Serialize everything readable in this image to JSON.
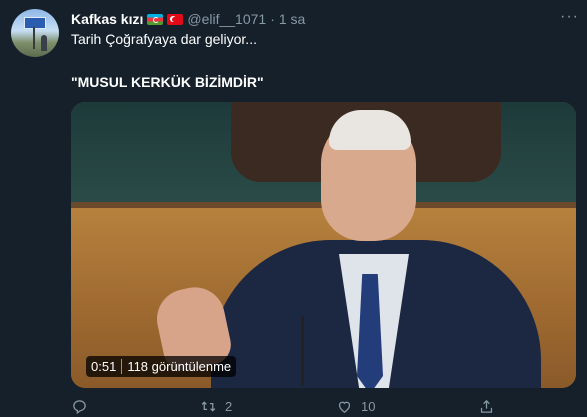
{
  "tweet": {
    "author_name": "Kafkas kızı",
    "flags": [
      "azerbaijan-flag",
      "turkey-flag"
    ],
    "handle": "@elif__1071",
    "separator": "·",
    "time": "1 sa",
    "text_line1": "Tarih Çoğrafyaya dar geliyor...",
    "text_line2": "\"MUSUL KERKÜK BİZİMDİR\"",
    "video": {
      "duration": "0:51",
      "views": "118 görüntülenme"
    },
    "actions": {
      "reply_count": "",
      "retweet_count": "2",
      "like_count": "10"
    }
  },
  "colors": {
    "background": "#15202b",
    "primary_text": "#ffffff",
    "secondary_text": "#8899a6"
  },
  "icons": {
    "more": "more-dots-icon",
    "reply": "reply-icon",
    "retweet": "retweet-icon",
    "like": "heart-icon",
    "share": "share-icon"
  }
}
